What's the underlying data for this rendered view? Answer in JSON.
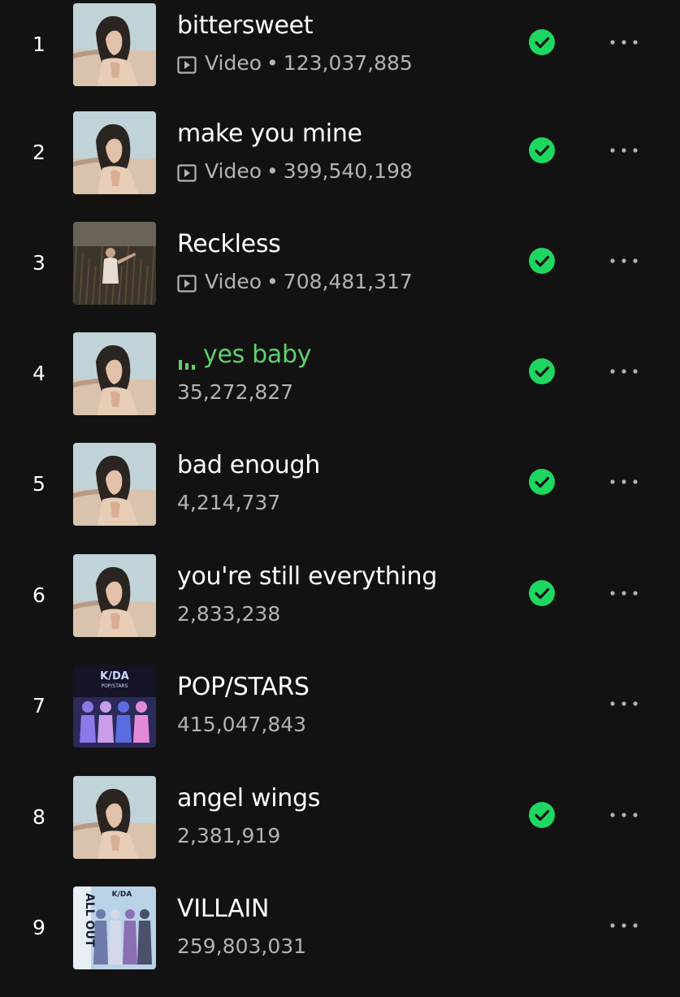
{
  "tracks": [
    {
      "rank": "1",
      "title": "bittersweet",
      "is_video": true,
      "video_label": "Video",
      "plays": "123,037,885",
      "saved": true,
      "playing": false,
      "art": "portrait"
    },
    {
      "rank": "2",
      "title": "make you mine",
      "is_video": true,
      "video_label": "Video",
      "plays": "399,540,198",
      "saved": true,
      "playing": false,
      "art": "portrait"
    },
    {
      "rank": "3",
      "title": "Reckless",
      "is_video": true,
      "video_label": "Video",
      "plays": "708,481,317",
      "saved": true,
      "playing": false,
      "art": "field"
    },
    {
      "rank": "4",
      "title": "yes baby",
      "is_video": false,
      "video_label": "",
      "plays": "35,272,827",
      "saved": true,
      "playing": true,
      "art": "portrait"
    },
    {
      "rank": "5",
      "title": "bad enough",
      "is_video": false,
      "video_label": "",
      "plays": "4,214,737",
      "saved": true,
      "playing": false,
      "art": "portrait"
    },
    {
      "rank": "6",
      "title": "you're still everything",
      "is_video": false,
      "video_label": "",
      "plays": "2,833,238",
      "saved": true,
      "playing": false,
      "art": "portrait"
    },
    {
      "rank": "7",
      "title": "POP/STARS",
      "is_video": false,
      "video_label": "",
      "plays": "415,047,843",
      "saved": false,
      "playing": false,
      "art": "kda-popstars"
    },
    {
      "rank": "8",
      "title": "angel wings",
      "is_video": false,
      "video_label": "",
      "plays": "2,381,919",
      "saved": true,
      "playing": false,
      "art": "portrait"
    },
    {
      "rank": "9",
      "title": "VILLAIN",
      "is_video": false,
      "video_label": "",
      "plays": "259,803,031",
      "saved": false,
      "playing": false,
      "art": "kda-allout"
    }
  ],
  "icons": {
    "saved": "check-circle-icon",
    "more": "more-options-icon",
    "video": "video-play-icon",
    "playing": "equalizer-icon"
  },
  "colors": {
    "background": "#121212",
    "accent_green": "#5fd16f",
    "saved_green": "#1ed760",
    "secondary_text": "#b3b3b3"
  },
  "art_text": {
    "kda-popstars": [
      "K/DA",
      "POP/STARS"
    ],
    "kda-allout": [
      "K/DA",
      "ALL OUT"
    ]
  }
}
